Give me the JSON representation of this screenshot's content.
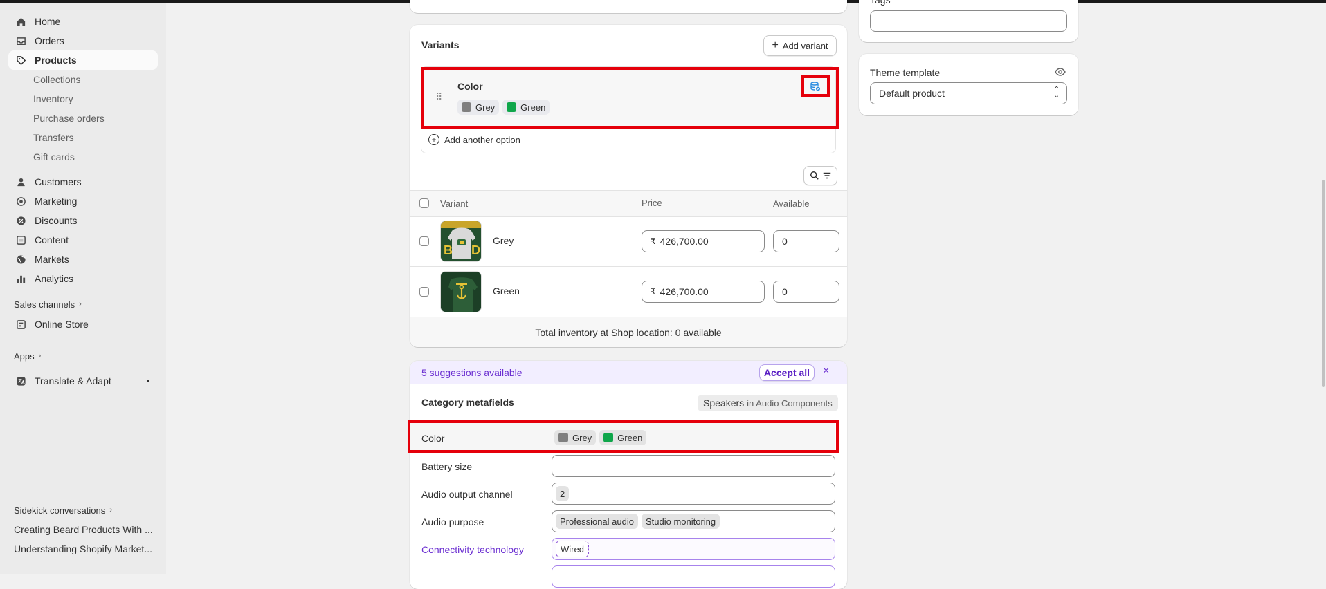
{
  "sidebar": {
    "nav": [
      {
        "label": "Home",
        "icon": "home-icon"
      },
      {
        "label": "Orders",
        "icon": "inbox-icon"
      },
      {
        "label": "Products",
        "icon": "tag-icon"
      }
    ],
    "product_sub": [
      "Collections",
      "Inventory",
      "Purchase orders",
      "Transfers",
      "Gift cards"
    ],
    "nav2": [
      {
        "label": "Customers",
        "icon": "person-icon"
      },
      {
        "label": "Marketing",
        "icon": "target-icon"
      },
      {
        "label": "Discounts",
        "icon": "discount-icon"
      },
      {
        "label": "Content",
        "icon": "content-icon"
      },
      {
        "label": "Markets",
        "icon": "globe-icon"
      },
      {
        "label": "Analytics",
        "icon": "chart-bar-icon"
      }
    ],
    "sales_channels": "Sales channels",
    "online_store": "Online Store",
    "apps": "Apps",
    "translate": "Translate & Adapt",
    "sidekick": "Sidekick conversations",
    "conversations": [
      "Creating Beard Products With ...",
      "Understanding Shopify Market..."
    ]
  },
  "variants": {
    "title": "Variants",
    "add_variant": "Add variant",
    "option_name": "Color",
    "option_values": [
      {
        "label": "Grey",
        "color": "#7f7f7f"
      },
      {
        "label": "Green",
        "color": "#0fa64a"
      }
    ],
    "add_option": "Add another option",
    "columns": {
      "variant": "Variant",
      "price": "Price",
      "available": "Available"
    },
    "rows": [
      {
        "name": "Grey",
        "price": "426,700.00",
        "available": "0"
      },
      {
        "name": "Green",
        "price": "426,700.00",
        "available": "0"
      }
    ],
    "currency_symbol": "₹",
    "total_inventory": "Total inventory at Shop location: 0 available"
  },
  "suggestions": {
    "text": "5 suggestions available",
    "accept_all": "Accept all",
    "accent": "#6b2fd1"
  },
  "metafields": {
    "title": "Category metafields",
    "category_name": "Speakers",
    "category_path": "in Audio Components",
    "color_label": "Color",
    "battery_label": "Battery size",
    "channel_label": "Audio output channel",
    "channel_value": "2",
    "purpose_label": "Audio purpose",
    "purpose_values": [
      "Professional audio",
      "Studio monitoring"
    ],
    "connectivity_label": "Connectivity technology",
    "connectivity_value": "Wired"
  },
  "right": {
    "tags_label": "Tags",
    "theme_label": "Theme template",
    "theme_value": "Default product"
  }
}
